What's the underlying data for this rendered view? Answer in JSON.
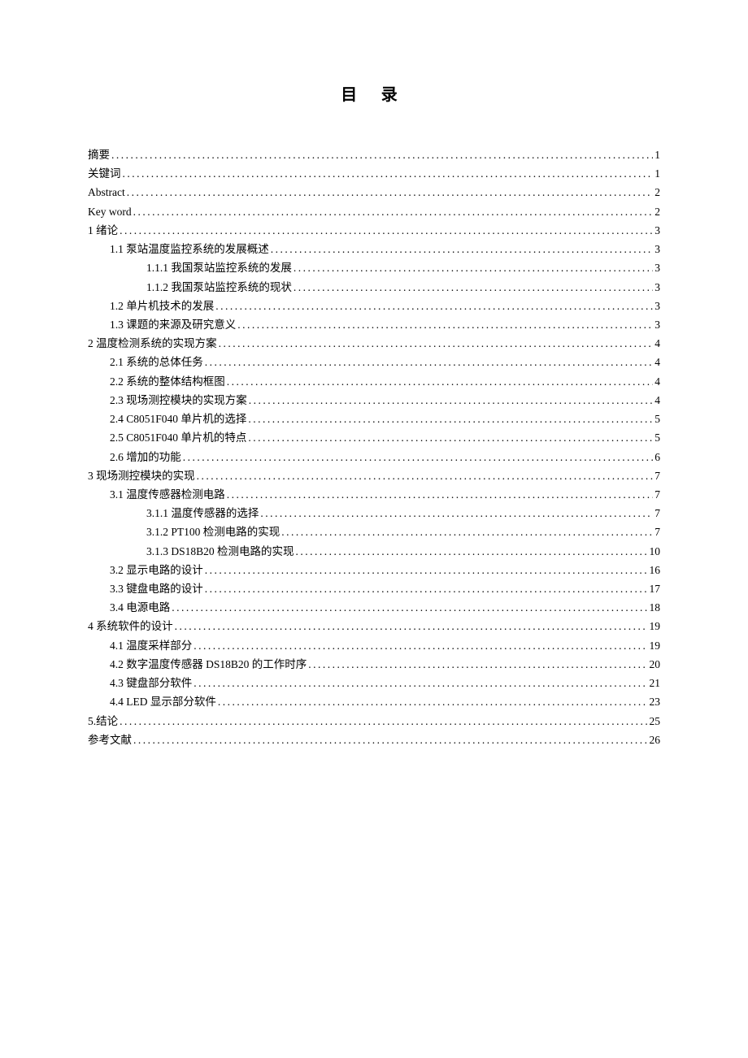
{
  "title": "目  录",
  "entries": [
    {
      "level": 0,
      "label": "摘要 ",
      "page": "1"
    },
    {
      "level": 0,
      "label": "关键词 ",
      "page": "1"
    },
    {
      "level": 0,
      "label": "Abstract",
      "page": "2"
    },
    {
      "level": 0,
      "label": "Key word ",
      "page": "2"
    },
    {
      "level": 0,
      "label": "1 绪论 ",
      "page": "3"
    },
    {
      "level": 1,
      "label": "1.1 泵站温度监控系统的发展概述 ",
      "page": "3"
    },
    {
      "level": 2,
      "label": "1.1.1 我国泵站监控系统的发展 ",
      "page": "3"
    },
    {
      "level": 2,
      "label": "1.1.2 我国泵站监控系统的现状 ",
      "page": "3"
    },
    {
      "level": 1,
      "label": "1.2 单片机技术的发展",
      "page": "3"
    },
    {
      "level": 1,
      "label": "1.3 课题的来源及研究意义 ",
      "page": "3"
    },
    {
      "level": 0,
      "label": "2 温度检测系统的实现方案 ",
      "page": "4"
    },
    {
      "level": 1,
      "label": "2.1 系统的总体任务",
      "page": "4"
    },
    {
      "level": 1,
      "label": "2.2 系统的整体结构框图 ",
      "page": "4"
    },
    {
      "level": 1,
      "label": "2.3 现场测控模块的实现方案",
      "page": "4"
    },
    {
      "level": 1,
      "label": "2.4 C8051F040 单片机的选择 ",
      "page": "5"
    },
    {
      "level": 1,
      "label": "2.5 C8051F040 单片机的特点",
      "page": "5"
    },
    {
      "level": 1,
      "label": "2.6 增加的功能 ",
      "page": "6"
    },
    {
      "level": 0,
      "label": "3 现场测控模块的实现 ",
      "page": "7"
    },
    {
      "level": 1,
      "label": "3.1 温度传感器检测电路 ",
      "page": "7"
    },
    {
      "level": 2,
      "label": "3.1.1  温度传感器的选择 ",
      "page": "7"
    },
    {
      "level": 2,
      "label": "3.1.2   PT100 检测电路的实现",
      "page": "7"
    },
    {
      "level": 2,
      "label": "3.1.3 DS18B20 检测电路的实现 ",
      "page": " 10"
    },
    {
      "level": 1,
      "label": "3.2 显示电路的设计 ",
      "page": " 16"
    },
    {
      "level": 1,
      "label": "3.3 键盘电路的设计 ",
      "page": " 17"
    },
    {
      "level": 1,
      "label": "3.4 电源电路",
      "page": " 18"
    },
    {
      "level": 0,
      "label": "4 系统软件的设计 ",
      "page": " 19"
    },
    {
      "level": 1,
      "label": "4.1 温度采样部分 ",
      "page": " 19"
    },
    {
      "level": 1,
      "label": "4.2 数字温度传感器 DS18B20 的工作时序 ",
      "page": " 20"
    },
    {
      "level": 1,
      "label": "4.3 键盘部分软件 ",
      "page": " 21"
    },
    {
      "level": 1,
      "label": "4.4 LED 显示部分软件 ",
      "page": " 23"
    },
    {
      "level": 0,
      "label": "5.结论",
      "page": " 25"
    },
    {
      "level": 0,
      "label": "参考文献 ",
      "page": " 26"
    }
  ]
}
